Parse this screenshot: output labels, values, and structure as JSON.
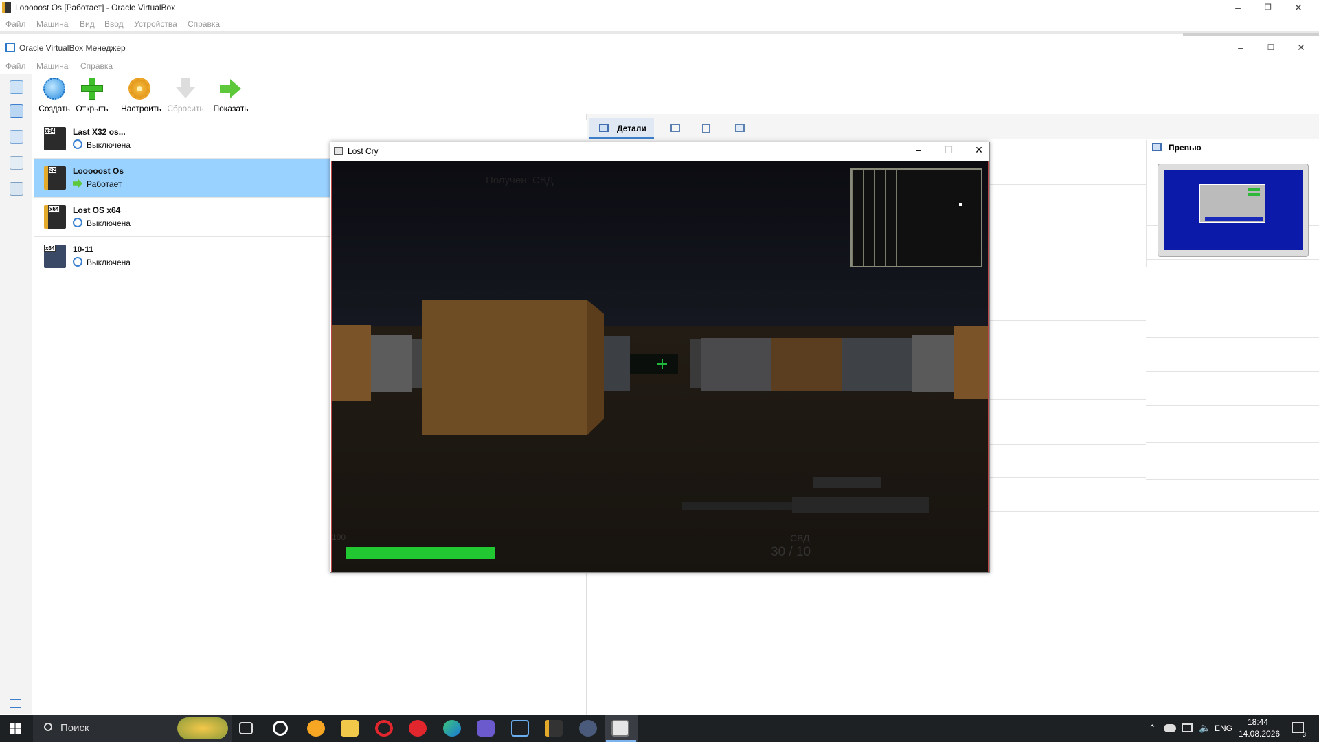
{
  "outer_window": {
    "title": "Looooost Os [Работает] - Oracle VirtualBox",
    "menu": [
      "Файл",
      "Машина",
      "Вид",
      "Ввод",
      "Устройства",
      "Справка"
    ]
  },
  "manager_window": {
    "title": "Oracle VirtualBox Менеджер",
    "menu": [
      "Файл",
      "Машина",
      "Справка"
    ]
  },
  "toolbar": {
    "buttons": [
      {
        "label": "Создать",
        "icon": "create-icon"
      },
      {
        "label": "Открыть",
        "icon": "add-icon"
      },
      {
        "label": "Настроить",
        "icon": "settings-gear-icon"
      },
      {
        "label": "Сбросить",
        "icon": "discard-arrow-icon"
      },
      {
        "label": "Показать",
        "icon": "show-arrow-icon"
      }
    ]
  },
  "vm_list": [
    {
      "name": "Last X32 os...",
      "arch": "x64",
      "state": "Выключена",
      "selected": false
    },
    {
      "name": "Looooost Os",
      "arch": "32",
      "state": "Работает",
      "selected": true
    },
    {
      "name": "Lost OS x64",
      "arch": "x64",
      "state": "Выключена",
      "selected": false
    },
    {
      "name": "10-11",
      "arch": "x64",
      "state": "Выключена",
      "selected": false
    }
  ],
  "tabs": {
    "active_label": "Детали"
  },
  "preview": {
    "title": "Превью"
  },
  "game_window": {
    "title": "Lost Cry",
    "hud": {
      "pickup_message": "Получен: СВД",
      "health": "100",
      "health_fraction": 0.36,
      "weapon": "СВД",
      "ammo": "30 / 10"
    }
  },
  "taskbar": {
    "search_placeholder": "Поиск",
    "lang": "ENG",
    "time": "18:44",
    "date": "14.08.2026",
    "notifications": "3"
  },
  "colors": {
    "selection": "#99d1ff",
    "health_bar": "#22c832",
    "taskbar": "#1e2124"
  }
}
